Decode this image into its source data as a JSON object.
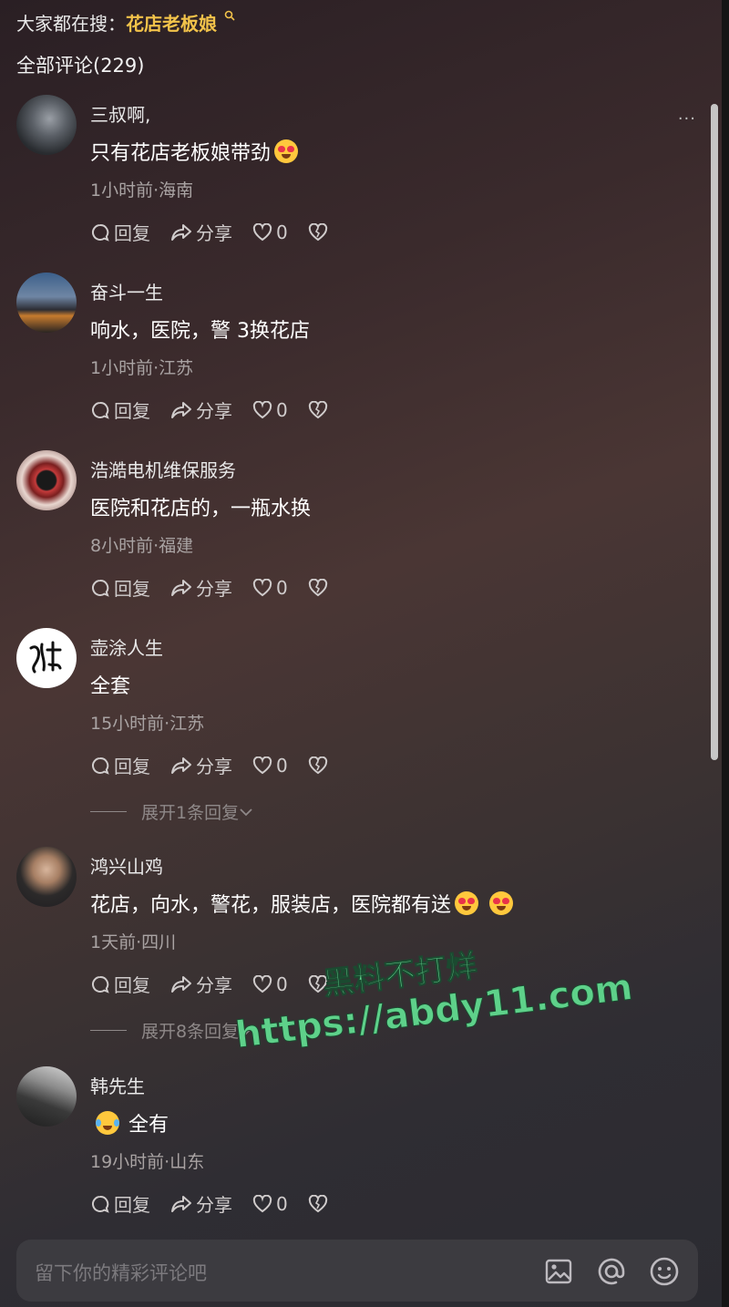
{
  "header": {
    "hot_search_label": "大家都在搜：",
    "hot_search_term": "花店老板娘",
    "comment_count_title": "全部评论(229)"
  },
  "action_labels": {
    "reply": "回复",
    "share": "分享"
  },
  "comments": [
    {
      "username": "三叔啊,",
      "content": "只有花店老板娘带劲",
      "emoji": [
        "heart-eyes"
      ],
      "meta": "1小时前·海南",
      "likes": "0"
    },
    {
      "username": "奋斗一生",
      "content": "响水，医院，警 3换花店",
      "emoji": [],
      "meta": "1小时前·江苏",
      "likes": "0"
    },
    {
      "username": "浩澔电机维保服务",
      "content": "医院和花店的，一瓶水换",
      "emoji": [],
      "meta": "8小时前·福建",
      "likes": "0"
    },
    {
      "username": "壶涂人生",
      "content": "全套",
      "emoji": [],
      "meta": "15小时前·江苏",
      "likes": "0",
      "expand": "展开1条回复"
    },
    {
      "username": "鸿兴山鸡",
      "content": "花店，向水，警花，服装店，医院都有送",
      "emoji": [
        "heart-eyes",
        "heart-eyes"
      ],
      "meta": "1天前·四川",
      "likes": "0",
      "expand": "展开8条回复"
    },
    {
      "username": "韩先生",
      "content": "全有",
      "emoji_before": [
        "laughing-tears"
      ],
      "meta": "19小时前·山东",
      "likes": "0"
    }
  ],
  "input": {
    "placeholder": "留下你的精彩评论吧"
  },
  "watermark": {
    "line1": "黑料不打烊",
    "line2": "https://abdy11.com"
  },
  "colors": {
    "accent": "#f2c34a",
    "watermark": "#5ed18a"
  }
}
